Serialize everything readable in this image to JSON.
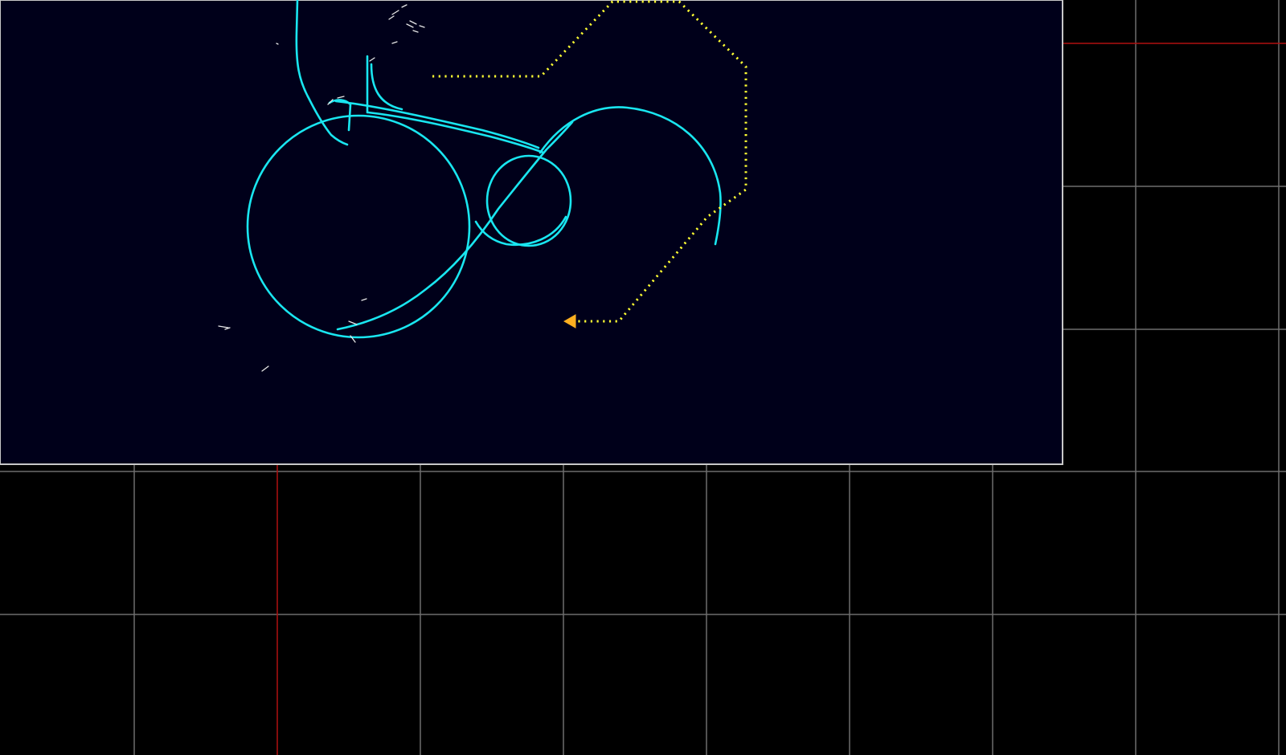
{
  "app": {
    "view": "radar-track-plot-canvas"
  },
  "colors": {
    "background": "#000000",
    "inset_background": "#00001a",
    "inset_border": "#c8c8c8",
    "grid_line": "#6e6e6e",
    "axis_line": "#b01010",
    "track_line": "#19e6f0",
    "planned_route": "#ffff33",
    "aircraft_marker": "#ffb020",
    "clutter": "#e8e8e8"
  },
  "icons": {
    "aircraft_marker": "triangle-left-icon"
  },
  "layers": [
    {
      "name": "grid",
      "visible": true
    },
    {
      "name": "reference-axes",
      "visible": true
    },
    {
      "name": "radar-inset",
      "visible": true
    },
    {
      "name": "flight-track",
      "visible": true
    },
    {
      "name": "planned-route",
      "visible": true
    },
    {
      "name": "radar-clutter",
      "visible": true
    },
    {
      "name": "aircraft-marker",
      "visible": true
    }
  ]
}
